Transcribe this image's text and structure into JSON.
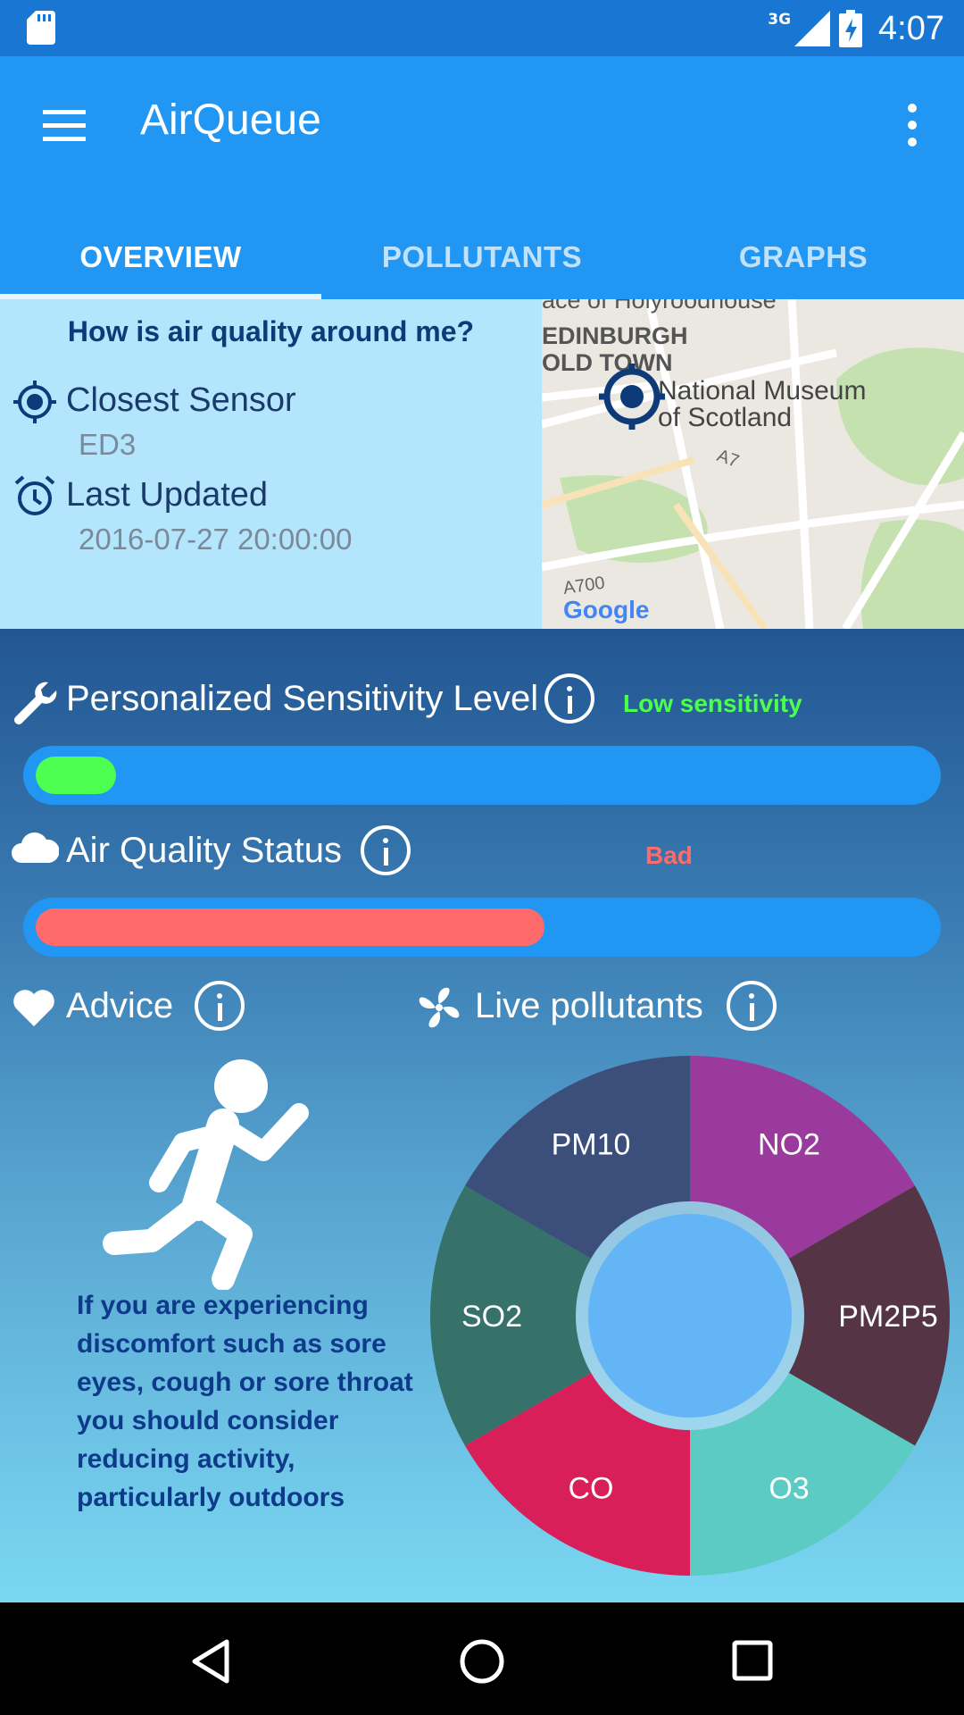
{
  "status_bar": {
    "network": "3G",
    "time": "4:07",
    "icons": [
      "sd-card-icon",
      "signal-icon",
      "battery-charging-icon"
    ]
  },
  "app_bar": {
    "title": "AirQueue",
    "menu_icon": "hamburger-menu-icon",
    "overflow_icon": "more-vert-icon"
  },
  "tabs": [
    {
      "label": "OVERVIEW",
      "active": true
    },
    {
      "label": "POLLUTANTS",
      "active": false
    },
    {
      "label": "GRAPHS",
      "active": false
    }
  ],
  "overview": {
    "question": "How is air quality around me?",
    "closest_sensor_label": "Closest Sensor",
    "closest_sensor_value": "ED3",
    "last_updated_label": "Last Updated",
    "last_updated_value": "2016-07-27 20:00:00"
  },
  "map": {
    "labels": [
      "ace of Holyroodhouse",
      "EDINBURGH",
      "OLD TOWN",
      "National Museum",
      "of Scotland",
      "A7",
      "A700"
    ],
    "watermark": "Google"
  },
  "sensitivity": {
    "title": "Personalized Sensitivity Level",
    "level_text": "Low sensitivity",
    "level_color": "#4cff4c",
    "fraction": 0.09,
    "fill_color": "#4cff50"
  },
  "air_quality": {
    "title": "Air Quality Status",
    "level_text": "Bad",
    "level_color": "#ff6b6b",
    "fraction": 0.57,
    "fill_color": "#ff6b6b"
  },
  "advice": {
    "title": "Advice",
    "icon": "running-person-icon",
    "text": "If you are experiencing discomfort such as sore eyes, cough or sore throat you should consider reducing activity, particularly outdoors"
  },
  "live_pollutants": {
    "title": "Live pollutants",
    "icon": "fan-icon"
  },
  "chart_data": {
    "type": "pie",
    "variant": "donut",
    "categories": [
      "NO2",
      "PM2P5",
      "O3",
      "CO",
      "SO2",
      "PM10"
    ],
    "values": [
      1,
      1,
      1,
      1,
      1,
      1
    ],
    "colors": [
      "#9b3a9d",
      "#553545",
      "#5ccbc4",
      "#d91f5a",
      "#36716a",
      "#3b4f7a"
    ]
  },
  "nav_bar": {
    "icons": [
      "back-icon",
      "home-icon",
      "recents-icon"
    ]
  }
}
